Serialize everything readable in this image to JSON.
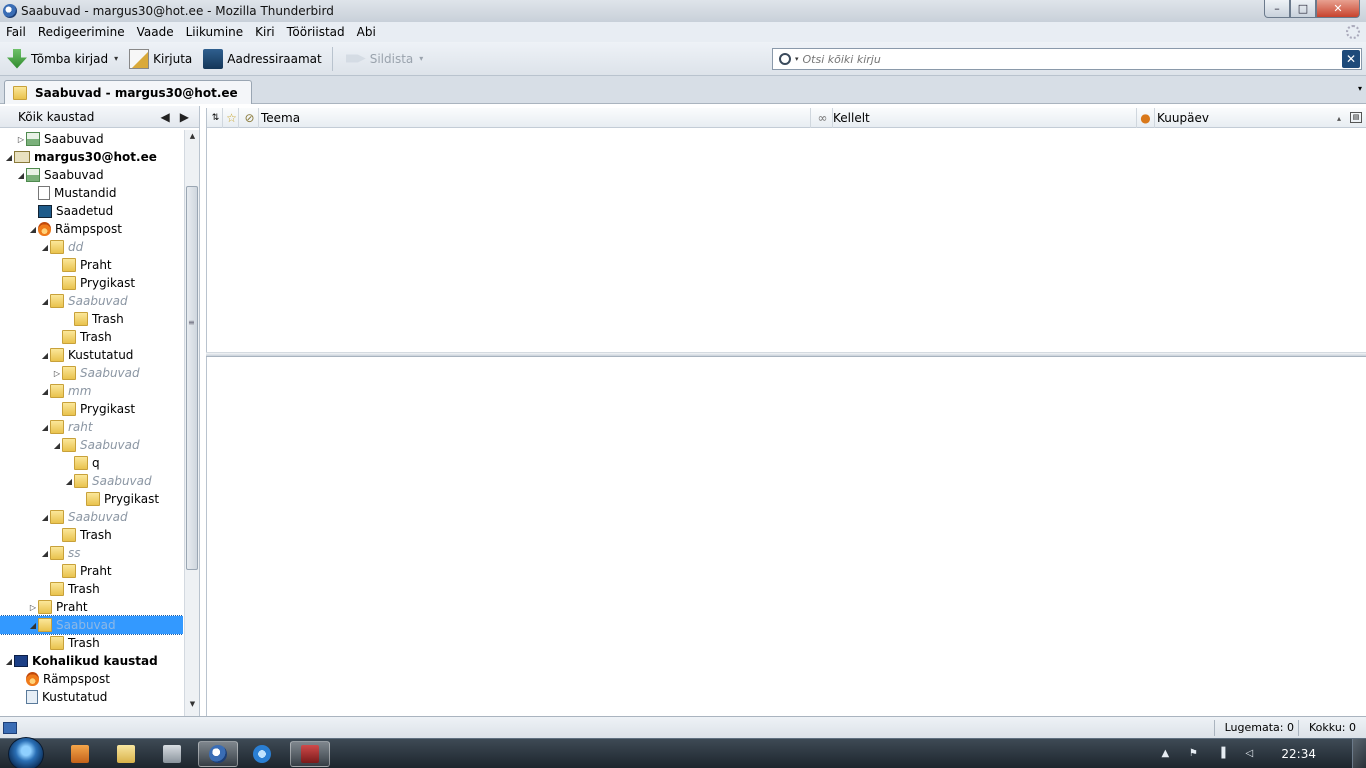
{
  "window": {
    "title": "Saabuvad - margus30@hot.ee - Mozilla Thunderbird",
    "minimize": "–",
    "maximize": "□",
    "close": "✕"
  },
  "menubar": {
    "items": [
      {
        "label": "Fail"
      },
      {
        "label": "Redigeerimine"
      },
      {
        "label": "Vaade"
      },
      {
        "label": "Liikumine"
      },
      {
        "label": "Kiri"
      },
      {
        "label": "Tööriistad"
      },
      {
        "label": "Abi"
      }
    ]
  },
  "toolbar": {
    "get_mail": "Tõmba kirjad",
    "write": "Kirjuta",
    "address_book": "Aadressiraamat",
    "tag": "Sildista",
    "dropdown_glyph": "▾"
  },
  "search": {
    "placeholder": "Otsi kõiki kirju",
    "clear": "✕"
  },
  "tabs": {
    "active_tab": "Saabuvad - margus30@hot.ee",
    "tab_list": "▾"
  },
  "folder_pane": {
    "header": "Kõik kaustad",
    "prev": "◀",
    "next": "▶",
    "folders": [
      {
        "label": "Saabuvad",
        "icon": "inbox-icon",
        "twisty": "▷"
      },
      {
        "label": "margus30@hot.ee",
        "icon": "account-icon",
        "twisty": "◢"
      },
      {
        "label": "Saabuvad",
        "icon": "inbox-icon",
        "twisty": "◢"
      },
      {
        "label": "Mustandid",
        "icon": "drafts-icon",
        "twisty": ""
      },
      {
        "label": "Saadetud",
        "icon": "sent-icon",
        "twisty": ""
      },
      {
        "label": "Rämpspost",
        "icon": "junk-icon",
        "twisty": "◢"
      },
      {
        "label": "dd",
        "icon": "folder-icon",
        "twisty": "◢"
      },
      {
        "label": "Praht",
        "icon": "folder-icon",
        "twisty": ""
      },
      {
        "label": "Prygikast",
        "icon": "folder-icon",
        "twisty": ""
      },
      {
        "label": "Saabuvad",
        "icon": "folder-icon",
        "twisty": "◢"
      },
      {
        "label": "Trash",
        "icon": "folder-icon",
        "twisty": ""
      },
      {
        "label": "Trash",
        "icon": "folder-icon",
        "twisty": ""
      },
      {
        "label": "Kustutatud",
        "icon": "folder-icon",
        "twisty": "◢"
      },
      {
        "label": "Saabuvad",
        "icon": "folder-icon",
        "twisty": "▷"
      },
      {
        "label": "mm",
        "icon": "folder-icon",
        "twisty": "◢"
      },
      {
        "label": "Prygikast",
        "icon": "folder-icon",
        "twisty": ""
      },
      {
        "label": "raht",
        "icon": "folder-icon",
        "twisty": "◢"
      },
      {
        "label": "Saabuvad",
        "icon": "folder-icon",
        "twisty": "◢"
      },
      {
        "label": "q",
        "icon": "folder-icon",
        "twisty": ""
      },
      {
        "label": "Saabuvad",
        "icon": "folder-icon",
        "twisty": "◢"
      },
      {
        "label": "Prygikast",
        "icon": "folder-icon",
        "twisty": ""
      },
      {
        "label": "Saabuvad",
        "icon": "folder-icon",
        "twisty": "◢"
      },
      {
        "label": "Trash",
        "icon": "folder-icon",
        "twisty": ""
      },
      {
        "label": "ss",
        "icon": "folder-icon",
        "twisty": "◢"
      },
      {
        "label": "Praht",
        "icon": "folder-icon",
        "twisty": ""
      },
      {
        "label": "Trash",
        "icon": "folder-icon",
        "twisty": ""
      },
      {
        "label": "Praht",
        "icon": "folder-icon",
        "twisty": "▷"
      },
      {
        "label": "Saabuvad",
        "icon": "folder-icon",
        "twisty": "◢"
      },
      {
        "label": "Trash",
        "icon": "folder-icon",
        "twisty": ""
      },
      {
        "label": "Kohalikud kaustad",
        "icon": "local-folders-icon",
        "twisty": "◢"
      },
      {
        "label": "Rämpspost",
        "icon": "junk-icon",
        "twisty": ""
      },
      {
        "label": "Kustutatud",
        "icon": "trash-icon",
        "twisty": ""
      }
    ],
    "scroll_up": "▲",
    "scroll_down": "▼",
    "grip": "≡"
  },
  "thread_pane": {
    "columns": {
      "thread": "⇅",
      "star": "☆",
      "attachment": "⊘",
      "subject": "Teema",
      "read": "∞",
      "from": "Kellelt",
      "junk": "●",
      "date": "Kuupäev",
      "sort_arrow": "▴",
      "picker": "▤"
    }
  },
  "statusbar": {
    "unread": "Lugemata: 0",
    "total": "Kokku: 0"
  },
  "taskbar": {
    "tray_show_hidden": "▲",
    "tray_flag": "⚑",
    "tray_network": "▐",
    "tray_volume": "◁",
    "clock": "22:34"
  }
}
